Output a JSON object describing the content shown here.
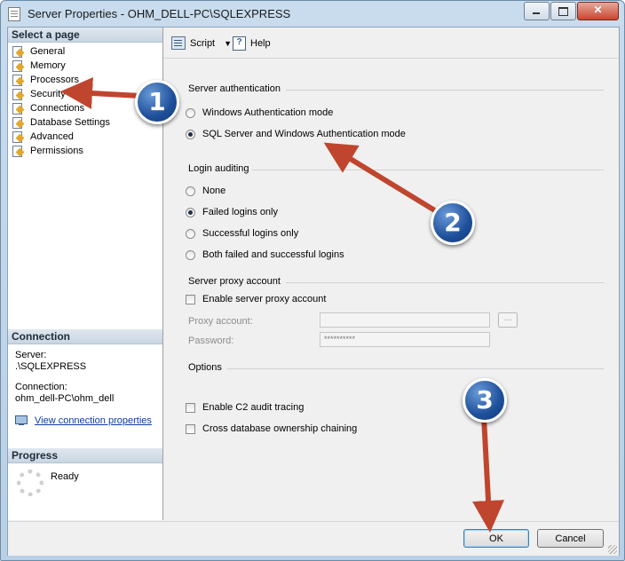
{
  "window": {
    "title": "Server Properties - OHM_DELL-PC\\SQLEXPRESS",
    "icons": {
      "app": "document-icon",
      "minimize": "minimize-icon",
      "maximize": "maximize-icon",
      "close": "close-icon"
    }
  },
  "sidebar": {
    "header": "Select a page",
    "items": [
      {
        "label": "General"
      },
      {
        "label": "Memory"
      },
      {
        "label": "Processors"
      },
      {
        "label": "Security"
      },
      {
        "label": "Connections"
      },
      {
        "label": "Database Settings"
      },
      {
        "label": "Advanced"
      },
      {
        "label": "Permissions"
      }
    ],
    "item_icon": "page-wrench-icon"
  },
  "connection": {
    "header": "Connection",
    "server_label": "Server:",
    "server_value": ".\\SQLEXPRESS",
    "connection_label": "Connection:",
    "connection_value": "ohm_dell-PC\\ohm_dell",
    "link": "View connection properties"
  },
  "progress": {
    "header": "Progress",
    "status": "Ready"
  },
  "toolbar": {
    "script_label": "Script",
    "help_label": "Help"
  },
  "server_auth": {
    "title": "Server authentication",
    "options": [
      {
        "label": "Windows Authentication mode",
        "selected": false
      },
      {
        "label": "SQL Server and Windows Authentication mode",
        "selected": true
      }
    ]
  },
  "login_auditing": {
    "title": "Login auditing",
    "options": [
      {
        "label": "None",
        "selected": false
      },
      {
        "label": "Failed logins only",
        "selected": true
      },
      {
        "label": "Successful logins only",
        "selected": false
      },
      {
        "label": "Both failed and successful logins",
        "selected": false
      }
    ]
  },
  "proxy": {
    "title": "Server proxy account",
    "enable_label": "Enable server proxy account",
    "enable_checked": false,
    "account_label": "Proxy account:",
    "account_value": "",
    "browse_label": "...",
    "password_label": "Password:",
    "password_value": "**********"
  },
  "options": {
    "title": "Options",
    "c2_label": "Enable C2 audit tracing",
    "c2_checked": false,
    "chaining_label": "Cross database ownership chaining",
    "chaining_checked": false
  },
  "buttons": {
    "ok": "OK",
    "cancel": "Cancel"
  },
  "annotations": {
    "badge1": "1",
    "badge2": "2",
    "badge3": "3",
    "arrow_color": "#c0452e"
  }
}
